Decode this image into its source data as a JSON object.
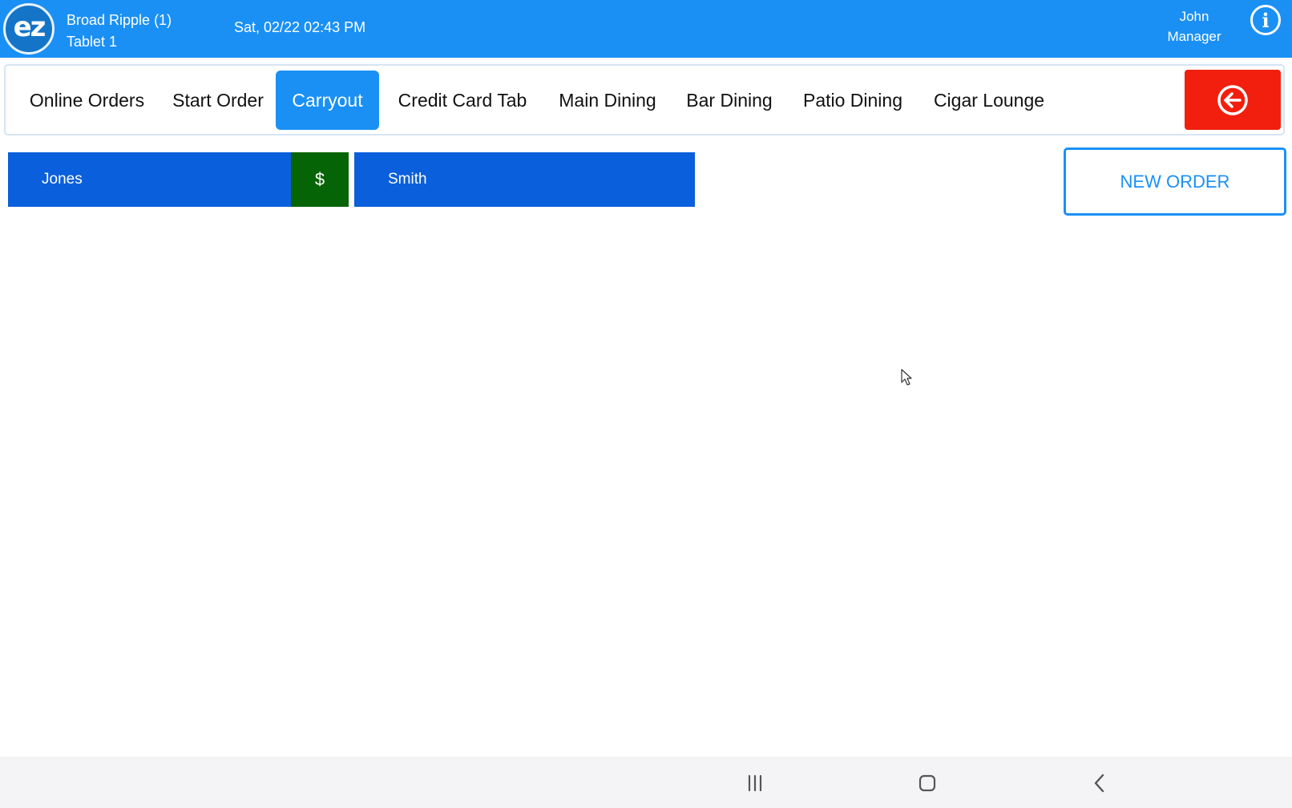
{
  "header": {
    "location": "Broad Ripple (1)",
    "device": "Tablet 1",
    "datetime": "Sat, 02/22 02:43 PM",
    "user_name": "John",
    "user_role": "Manager",
    "logo_text": "ez",
    "info_icon": "info-icon"
  },
  "tabs": [
    {
      "label": "Online Orders",
      "active": false
    },
    {
      "label": "Start Order",
      "active": false
    },
    {
      "label": "Carryout",
      "active": true
    },
    {
      "label": "Credit Card Tab",
      "active": false
    },
    {
      "label": "Main Dining",
      "active": false
    },
    {
      "label": "Bar Dining",
      "active": false
    },
    {
      "label": "Patio Dining",
      "active": false
    },
    {
      "label": "Cigar Lounge",
      "active": false
    }
  ],
  "exit_icon": "arrow-left-circle-icon",
  "orders": [
    {
      "name": "Jones",
      "paid_label": "$"
    },
    {
      "name": "Smith"
    }
  ],
  "new_order_label": "NEW ORDER",
  "colors": {
    "header_bg": "#1a90f5",
    "active_tab": "#1a90f5",
    "exit_button": "#f21f0e",
    "order_tile": "#0a5fdc",
    "paid_badge": "#056405"
  }
}
